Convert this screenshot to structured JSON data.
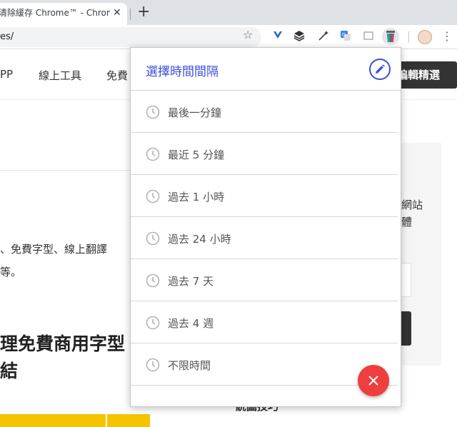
{
  "browser": {
    "tab_title": "清除緩存 Chrome™ - Chrome 網路應用程式商店",
    "tab_close": "✕",
    "new_tab": "+",
    "url": "es/",
    "star": "☆",
    "menu": "⋮"
  },
  "extensions": [
    "vee-icon",
    "layers-icon",
    "magic-wand-icon",
    "translate-icon",
    "window-icon",
    "clear-cache-icon"
  ],
  "site": {
    "nav_items": [
      "PP",
      "線上工具",
      "免費"
    ],
    "nav_cta": "編輯精選",
    "para_1": "、免費字型、線上翻譯",
    "para_2": "等。",
    "heading_1": "理免費商用字型",
    "heading_2": "結",
    "side_1": "網站",
    "side_2": "體",
    "bottom_heading": "統圖技巧"
  },
  "popup": {
    "title": "選擇時間間隔",
    "options": [
      "最後一分鐘",
      "最近 5 分鐘",
      "過去 1 小時",
      "過去 24 小時",
      "過去 7 天",
      "過去 4 週",
      "不限時間"
    ],
    "colors": {
      "accent": "#3d4ed8",
      "fab": "#ef3e3e",
      "text": "#555555"
    }
  }
}
